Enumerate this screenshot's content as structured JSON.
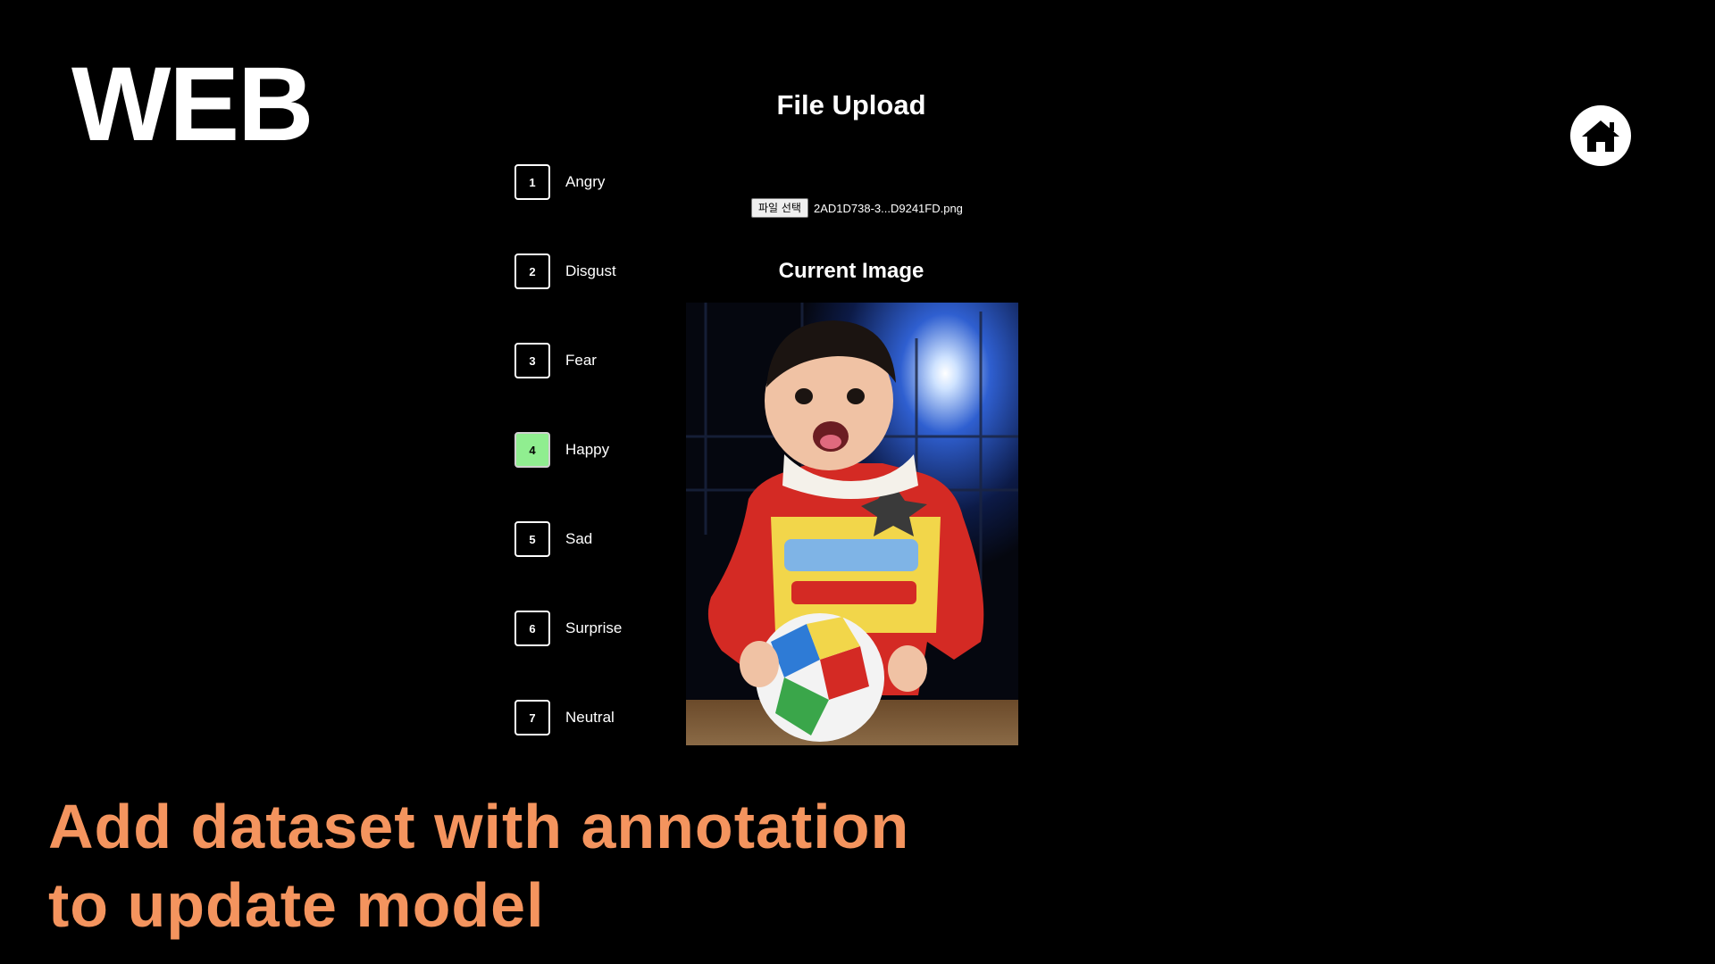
{
  "slide": {
    "title": "WEB",
    "caption_line1": "Add dataset with annotation",
    "caption_line2": "to update model",
    "caption_color": "#f4945e"
  },
  "header": {
    "home_icon": "home-icon"
  },
  "upload": {
    "title": "File Upload",
    "choose_file_label": "파일 선택",
    "file_name": "2AD1D738-3...D9241FD.png"
  },
  "preview": {
    "title": "Current Image",
    "image_content": "photo-of-toddler-holding-ball"
  },
  "emotions": [
    {
      "key": "1",
      "label": "Angry",
      "selected": false
    },
    {
      "key": "2",
      "label": "Disgust",
      "selected": false
    },
    {
      "key": "3",
      "label": "Fear",
      "selected": false
    },
    {
      "key": "4",
      "label": "Happy",
      "selected": true
    },
    {
      "key": "5",
      "label": "Sad",
      "selected": false
    },
    {
      "key": "6",
      "label": "Surprise",
      "selected": false
    },
    {
      "key": "7",
      "label": "Neutral",
      "selected": false
    }
  ],
  "colors": {
    "background": "#000000",
    "selected_box": "#90ee90",
    "text": "#ffffff"
  }
}
